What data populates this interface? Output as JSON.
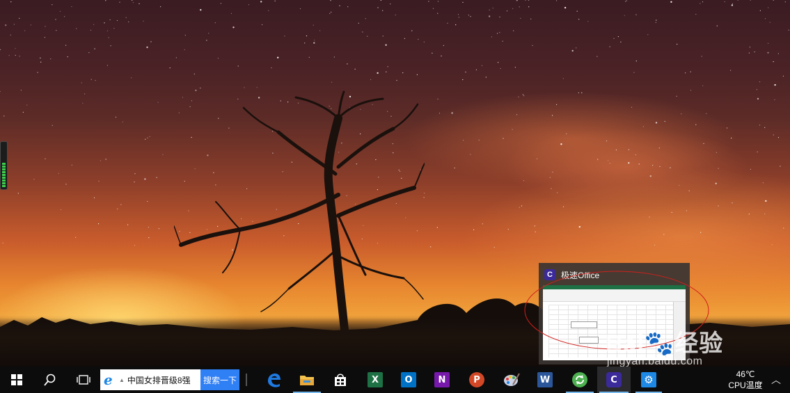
{
  "desktop": {
    "wallpaper": "starry-sky-with-tree",
    "accent_colors": {
      "sky_top": "#3a1c22",
      "horizon": "#f0a03a",
      "ground": "#120b08"
    }
  },
  "preview": {
    "app_icon": "C",
    "title": "极速Office",
    "annotation_color": "#d0201c"
  },
  "watermark": {
    "brand_prefix": "Bai",
    "brand_suffix": "经验",
    "url": "jingyan.baidu.com"
  },
  "taskbar": {
    "search": {
      "query": "中国女排晋级8强",
      "button_label": "搜索一下"
    },
    "apps": [
      {
        "name": "Edge",
        "icon": "edge-icon",
        "color": "#1f7ae0"
      },
      {
        "name": "File Explorer",
        "icon": "folder-icon",
        "color": "#f2c14e"
      },
      {
        "name": "Store",
        "icon": "store-icon",
        "color": "#ffffff"
      },
      {
        "name": "Excel",
        "icon": "excel-icon",
        "color": "#1e7145",
        "letter": "X"
      },
      {
        "name": "Outlook",
        "icon": "outlook-icon",
        "color": "#0072c6",
        "letter": "O"
      },
      {
        "name": "OneNote",
        "icon": "onenote-icon",
        "color": "#7719aa",
        "letter": "N"
      },
      {
        "name": "PowerPoint",
        "icon": "powerpoint-icon",
        "color": "#d24726",
        "letter": "P"
      },
      {
        "name": "Paint",
        "icon": "paint-icon",
        "color": "#9aa7c7"
      },
      {
        "name": "Word",
        "icon": "word-icon",
        "color": "#2b579a",
        "letter": "W"
      },
      {
        "name": "Updater",
        "icon": "refresh-icon",
        "color": "#4caf50"
      },
      {
        "name": "极速Office",
        "icon": "jisu-office-icon",
        "color": "#3b2a9a",
        "letter": "C"
      },
      {
        "name": "Settings",
        "icon": "gear-icon",
        "color": "#1e88e5"
      }
    ],
    "tray": {
      "temperature": "46℃",
      "temperature_label": "CPU温度"
    }
  }
}
